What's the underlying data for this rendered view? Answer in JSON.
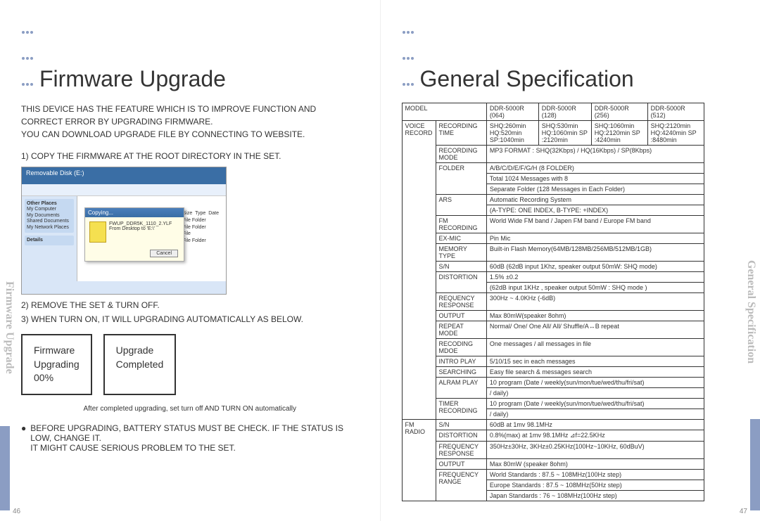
{
  "left": {
    "title": "Firmware Upgrade",
    "intro1": "THIS DEVICE HAS THE FEATURE WHICH IS TO IMPROVE FUNCTION AND CORRECT ERROR BY UPGRADING FIRMWARE.",
    "intro2": "YOU CAN DOWNLOAD UPGRADE FILE BY CONNECTING TO WEBSITE.",
    "step1": "1) COPY THE FIRMWARE AT THE ROOT DIRECTORY IN THE SET.",
    "step2": "2) REMOVE THE SET & TURN OFF.",
    "step3": "3) WHEN TURN ON, IT WILL UPGRADING AUTOMATICALLY AS BELOW.",
    "box1_l1": "Firmware",
    "box1_l2": "Upgrading",
    "box1_l3": "00%",
    "box2_l1": "Upgrade",
    "box2_l2": "Completed",
    "note": "After completed upgrading, set turn off AND TURN ON automatically",
    "bullet1a": "BEFORE UPGRADING, BATTERY STATUS MUST BE CHECK. IF THE STATUS IS LOW, CHANGE IT.",
    "bullet1b": "IT MIGHT CAUSE SERIOUS PROBLEM TO THE SET.",
    "sidetab": "Firmware Upgrade",
    "page": "46",
    "ss": {
      "title_bar": "Removable Disk (E:)",
      "dialog_title": "Copying...",
      "dialog_file": "FWUP_DDR5K_1110_2.YLF",
      "dialog_from": "From Desktop to 'E:\\'",
      "dialog_cancel": "Cancel",
      "col_size": "Size",
      "col_type": "Type",
      "col_date": "Date",
      "type_folder": "File Folder",
      "type_file": "File",
      "side_other": "Other Places",
      "side_my_computer": "My Computer",
      "side_my_documents": "My Documents",
      "side_shared": "Shared Documents",
      "side_network": "My Network Places",
      "side_details": "Details"
    }
  },
  "right": {
    "title": "General Specification",
    "sidetab": "General Specification",
    "page": "47",
    "head": {
      "model": "MODEL",
      "c1": "DDR-5000R (064)",
      "c2": "DDR-5000R (128)",
      "c3": "DDR-5000R (256)",
      "c4": "DDR-5000R (512)"
    },
    "voice": {
      "label": "VOICE RECORD",
      "rows": {
        "rec_time": {
          "k": "RECORDING TIME",
          "c1": "SHQ:260min HQ:520min SP:1040min",
          "c2": "SHQ:530min HQ:1060min SP :2120min",
          "c3": "SHQ:1060min HQ:2120min SP :4240min",
          "c4": "SHQ:2120min HQ:4240min SP :8480min"
        },
        "rec_mode": {
          "k": "RECORDING MODE",
          "v": "MP3 FORMAT : SHQ(32Kbps) / HQ(16Kbps) / SP(8Kbps)"
        },
        "folder": {
          "k": "FOLDER",
          "v1": "A/B/C/D/E/F/G/H (8 FOLDER)",
          "v2": "Total 1024 Messages with 8",
          "v3": "Separate Folder (128 Messages in Each Folder)"
        },
        "ars": {
          "k": "ARS",
          "v1": "Automatic Recording System",
          "v2": "(A-TYPE: ONE INDEX, B-TYPE: +INDEX)"
        },
        "fm_rec": {
          "k": "FM RECORDING",
          "v": "World Wide FM band / Japen FM band / Europe FM band"
        },
        "ex_mic": {
          "k": "EX-MIC",
          "v": "Pin Mic"
        },
        "mem": {
          "k": "MEMORY TYPE",
          "v": "Built-in Flash Memory(64MB/128MB/256MB/512MB/1GB)"
        },
        "sn": {
          "k": "S/N",
          "v": "60dB (62dB input 1Khz, speaker output 50mW: SHQ mode)"
        },
        "dist": {
          "k": "DISTORTION",
          "v1": "1.5% ±0.2",
          "v2": "(62dB input 1KHz , speaker output 50mW : SHQ mode )"
        },
        "freq": {
          "k": "REQUENCY RESPONSE",
          "v": "300Hz ~ 4.0KHz (-6dB)"
        },
        "out": {
          "k": "OUTPUT",
          "v": "Max 80mW(speaker 8ohm)"
        },
        "repeat": {
          "k": "REPEAT MODE",
          "v": "Normal/ One/ One All/ All/ Shuffle/A↔B repeat"
        },
        "recmode": {
          "k": "RECODING MDOE",
          "v": "One messages / all messages in file"
        },
        "intro": {
          "k": "INTRO PLAY",
          "v": "5/10/15 sec in each messages"
        },
        "search": {
          "k": "SEARCHING",
          "v": "Easy file search & messages search"
        },
        "alarm": {
          "k": "ALRAM PLAY",
          "v1": "10 program (Date / weekly(sun/mon/tue/wed/thu/fri/sat)",
          "v2": "/ daily)"
        },
        "timer": {
          "k": "TIMER RECORDING",
          "v1": "10 program (Date / weekly(sun/mon/tue/wed/thu/fri/sat)",
          "v2": "/ daily)"
        }
      }
    },
    "fm": {
      "label": "FM RADIO",
      "rows": {
        "sn": {
          "k": "S/N",
          "v": "60dB at 1mv 98.1MHz"
        },
        "dist": {
          "k": "DISTORTION",
          "v": "0.8%(max) at 1mv 98.1MHz ⊿f=22.5KHz"
        },
        "freq": {
          "k": "FREQUENCY RESPONSE",
          "v": "350Hz±30Hz, 3KHz±0.25KHz(100Hz~10KHz, 60dBuV)"
        },
        "out": {
          "k": "OUTPUT",
          "v": "Max 80mW (speaker 8ohm)"
        },
        "range": {
          "k": "FREQUENCY RANGE",
          "v1": "World Standards : 87.5 ~ 108MHz(100Hz step)",
          "v2": "Europe Standards : 87.5 ~ 108MHz(50Hz step)",
          "v3": "Japan Standards : 76 ~ 108MHz(100Hz step)"
        }
      }
    }
  }
}
